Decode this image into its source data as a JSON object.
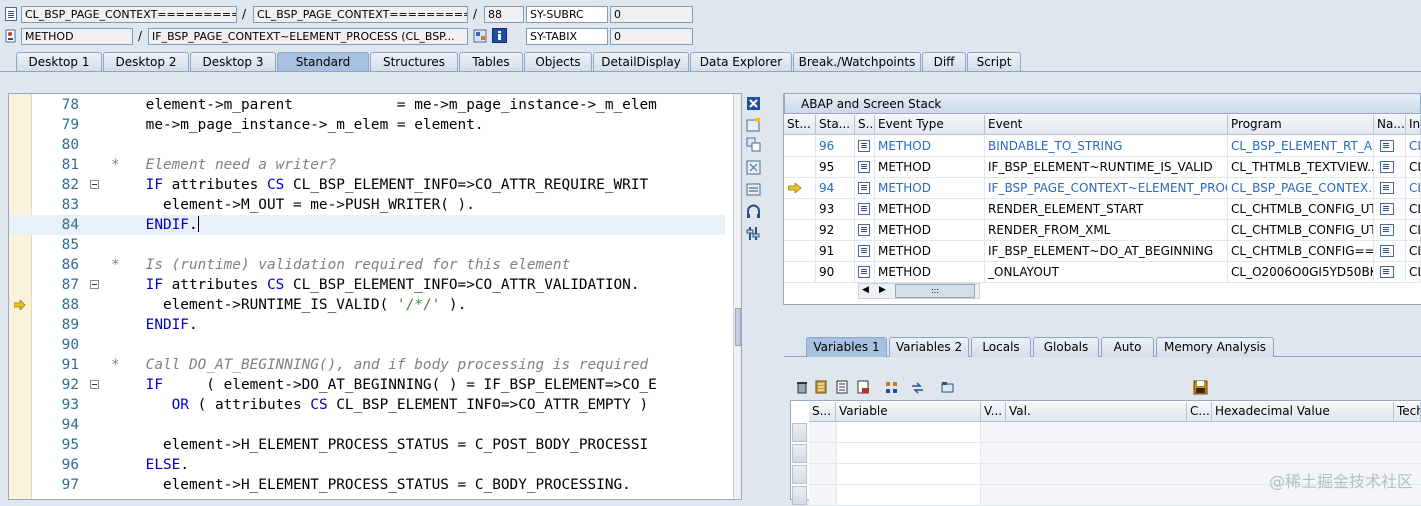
{
  "header": {
    "row1": {
      "field1": "CL_BSP_PAGE_CONTEXT==========...",
      "field2": "CL_BSP_PAGE_CONTEXT==========...",
      "sep1": "/",
      "sep2": "/",
      "line": "88",
      "sysvar": "SY-SUBRC",
      "sysval": "0"
    },
    "row2": {
      "field1": "METHOD",
      "field2": "IF_BSP_PAGE_CONTEXT~ELEMENT_PROCESS (CL_BSP...",
      "sep1": "/",
      "sysvar": "SY-TABIX",
      "sysval": "0"
    }
  },
  "tabs": [
    "Desktop 1",
    "Desktop 2",
    "Desktop 3",
    "Standard",
    "Structures",
    "Tables",
    "Objects",
    "DetailDisplay",
    "Data Explorer",
    "Break./Watchpoints",
    "Diff",
    "Script"
  ],
  "active_tab": "Standard",
  "editor": {
    "lines": [
      {
        "n": "78",
        "code": [
          [
            "",
            "    element->m_parent            = me->m_page_instance->_m_elem"
          ]
        ]
      },
      {
        "n": "79",
        "code": [
          [
            "",
            "    me->m_page_instance->_m_elem = element."
          ]
        ]
      },
      {
        "n": "80",
        "code": [
          [
            "",
            ""
          ]
        ]
      },
      {
        "n": "81",
        "code": [
          [
            "cm",
            "*   Element need a writer?"
          ]
        ]
      },
      {
        "n": "82",
        "fold": true,
        "code": [
          [
            "kw",
            "    IF"
          ],
          [
            "",
            " attributes "
          ],
          [
            "kw",
            "CS"
          ],
          [
            "",
            " CL_BSP_ELEMENT_INFO=>CO_ATTR_REQUIRE_WRIT"
          ]
        ]
      },
      {
        "n": "83",
        "code": [
          [
            "",
            "      element->M_OUT = me->PUSH_WRITER( )."
          ]
        ]
      },
      {
        "n": "84",
        "cur": true,
        "code": [
          [
            "kw",
            "    ENDIF"
          ],
          [
            "",
            "."
          ]
        ]
      },
      {
        "n": "85",
        "code": [
          [
            "",
            ""
          ]
        ]
      },
      {
        "n": "86",
        "code": [
          [
            "cm",
            "*   Is (runtime) validation required for this element"
          ]
        ]
      },
      {
        "n": "87",
        "fold": true,
        "code": [
          [
            "kw",
            "    IF"
          ],
          [
            "",
            " attributes "
          ],
          [
            "kw",
            "CS"
          ],
          [
            "",
            " CL_BSP_ELEMENT_INFO=>CO_ATTR_VALIDATION."
          ]
        ]
      },
      {
        "n": "88",
        "arrow": true,
        "code": [
          [
            "",
            "      element->RUNTIME_IS_VALID( "
          ],
          [
            "st",
            "'/*/'"
          ],
          [
            "",
            " )."
          ]
        ]
      },
      {
        "n": "89",
        "code": [
          [
            "kw",
            "    ENDIF"
          ],
          [
            "",
            "."
          ]
        ]
      },
      {
        "n": "90",
        "code": [
          [
            "",
            ""
          ]
        ]
      },
      {
        "n": "91",
        "code": [
          [
            "cm",
            "*   Call DO_AT_BEGINNING(), and if body processing is required"
          ]
        ]
      },
      {
        "n": "92",
        "fold": true,
        "code": [
          [
            "kw",
            "    IF"
          ],
          [
            "",
            "     ( element->DO_AT_BEGINNING( ) = IF_BSP_ELEMENT=>CO_E"
          ]
        ]
      },
      {
        "n": "93",
        "code": [
          [
            "kw",
            "       OR"
          ],
          [
            "",
            " ( attributes "
          ],
          [
            "kw",
            "CS"
          ],
          [
            "",
            " CL_BSP_ELEMENT_INFO=>CO_ATTR_EMPTY )"
          ]
        ]
      },
      {
        "n": "94",
        "code": [
          [
            "",
            ""
          ]
        ]
      },
      {
        "n": "95",
        "code": [
          [
            "",
            "      element->H_ELEMENT_PROCESS_STATUS = C_POST_BODY_PROCESSI"
          ]
        ]
      },
      {
        "n": "96",
        "code": [
          [
            "kw",
            "    ELSE"
          ],
          [
            "",
            "."
          ]
        ]
      },
      {
        "n": "97",
        "code": [
          [
            "",
            "      element->H_ELEMENT_PROCESS_STATUS = C_BODY_PROCESSING."
          ]
        ]
      }
    ]
  },
  "stack": {
    "title": "ABAP and Screen Stack",
    "columns": [
      "St...",
      "Sta...",
      "S...",
      "Event Type",
      "Event",
      "Program",
      "Na...",
      "In"
    ],
    "rows": [
      {
        "sta": "96",
        "type": "METHOD",
        "event": "BINDABLE_TO_STRING",
        "program": "CL_BSP_ELEMENT_RT_A...",
        "inc": "CL",
        "link": true
      },
      {
        "sta": "95",
        "type": "METHOD",
        "event": "IF_BSP_ELEMENT~RUNTIME_IS_VALID",
        "program": "CL_THTMLB_TEXTVIEW...",
        "inc": "CL",
        "link": false
      },
      {
        "sta": "94",
        "type": "METHOD",
        "event": "IF_BSP_PAGE_CONTEXT~ELEMENT_PROC...",
        "program": "CL_BSP_PAGE_CONTEX...",
        "inc": "CL",
        "link": true,
        "current": true
      },
      {
        "sta": "93",
        "type": "METHOD",
        "event": "RENDER_ELEMENT_START",
        "program": "CL_CHTMLB_CONFIG_UT...",
        "inc": "CL",
        "link": false
      },
      {
        "sta": "92",
        "type": "METHOD",
        "event": "RENDER_FROM_XML",
        "program": "CL_CHTMLB_CONFIG_UT...",
        "inc": "CL",
        "link": false
      },
      {
        "sta": "91",
        "type": "METHOD",
        "event": "IF_BSP_ELEMENT~DO_AT_BEGINNING",
        "program": "CL_CHTMLB_CONFIG==...",
        "inc": "CL",
        "link": false
      },
      {
        "sta": "90",
        "type": "METHOD",
        "event": "_ONLAYOUT",
        "program": "CL_O2006O0GI5YD50BK...",
        "inc": "CL",
        "link": false
      }
    ],
    "scroll_dots": ":::"
  },
  "lower_tabs": [
    "Variables 1",
    "Variables 2",
    "Locals",
    "Globals",
    "Auto",
    "Memory Analysis"
  ],
  "lower_active": "Variables 1",
  "variables": {
    "columns": [
      "S...",
      "Variable",
      "V...",
      "Val.",
      "C...",
      "Hexadecimal Value",
      "Tech"
    ]
  },
  "watermark": "@稀土掘金技术社区"
}
